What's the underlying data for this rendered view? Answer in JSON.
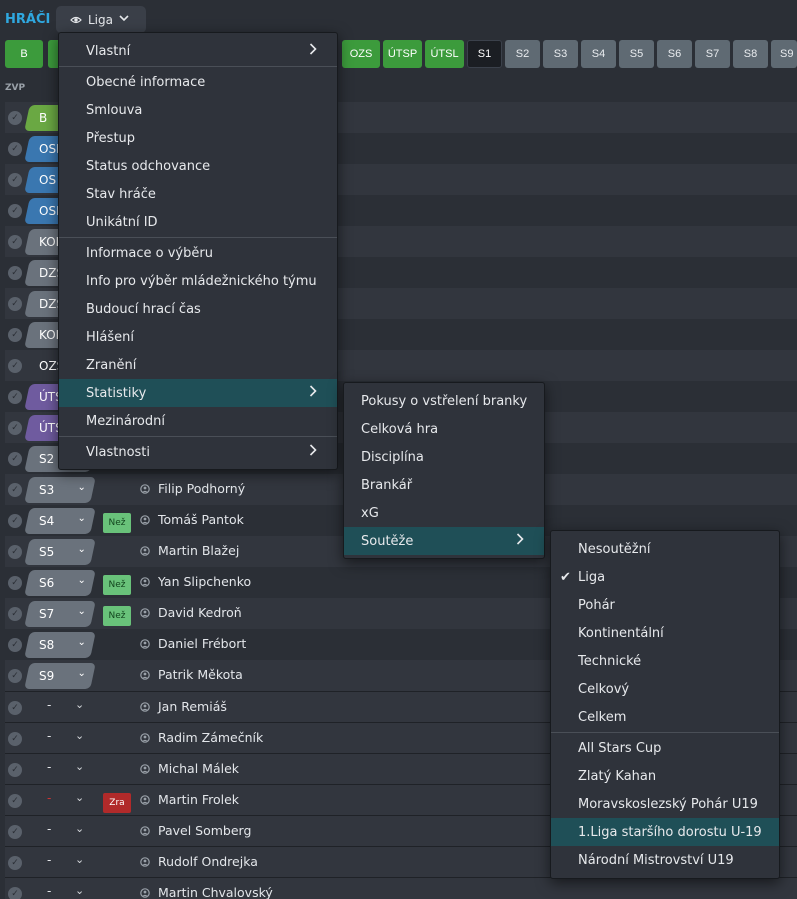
{
  "header": {
    "title": "HRÁČI",
    "view_label": "Liga"
  },
  "chips": [
    "B",
    "OZS",
    "ÚTSP",
    "ÚTSL",
    "S1",
    "S2",
    "S3",
    "S4",
    "S5",
    "S6",
    "S7",
    "S8",
    "S9"
  ],
  "section_label": "ZVP",
  "rows": [
    {
      "pos": "B",
      "color": "green"
    },
    {
      "pos": "OSP",
      "color": "blue"
    },
    {
      "pos": "OS",
      "color": "blue"
    },
    {
      "pos": "OSL",
      "color": "blue"
    },
    {
      "pos": "KOP",
      "color": "grey"
    },
    {
      "pos": "DZS",
      "color": "grey"
    },
    {
      "pos": "DZS",
      "color": "grey"
    },
    {
      "pos": "KOL",
      "color": "grey"
    },
    {
      "pos": "OZS",
      "color": "none"
    },
    {
      "pos": "ÚTSP",
      "color": "purple"
    },
    {
      "pos": "ÚTSL",
      "color": "purple"
    },
    {
      "pos": "S2",
      "color": "grey"
    },
    {
      "pos": "S3",
      "color": "grey",
      "name": "Filip Podhorný"
    },
    {
      "pos": "S4",
      "color": "grey",
      "badge": "Než",
      "name": "Tomáš Pantok"
    },
    {
      "pos": "S5",
      "color": "grey",
      "name": "Martin Blažej"
    },
    {
      "pos": "S6",
      "color": "grey",
      "badge": "Než",
      "name": "Yan Slipchenko"
    },
    {
      "pos": "S7",
      "color": "grey",
      "badge": "Než",
      "name": "David Kedroň"
    },
    {
      "pos": "S8",
      "color": "grey",
      "name": "Daniel Frébort"
    },
    {
      "pos": "S9",
      "color": "grey",
      "name": "Patrik Měkota"
    },
    {
      "pos": "-",
      "name": "Jan Remiáš"
    },
    {
      "pos": "-",
      "name": "Radim Zámečník"
    },
    {
      "pos": "-",
      "name": "Michal Málek"
    },
    {
      "pos": "-",
      "red": true,
      "badge": "Zra",
      "name": "Martin Frolek"
    },
    {
      "pos": "-",
      "name": "Pavel Somberg"
    },
    {
      "pos": "-",
      "name": "Rudolf Ondrejka"
    },
    {
      "pos": "-",
      "name": "Martin Chvalovský"
    }
  ],
  "menu1": {
    "items": [
      {
        "label": "Vlastní",
        "submenu": true
      },
      {
        "label": "Obecné informace"
      },
      {
        "label": "Smlouva"
      },
      {
        "label": "Přestup"
      },
      {
        "label": "Status odchovance"
      },
      {
        "label": "Stav hráče"
      },
      {
        "label": "Unikátní ID"
      },
      {
        "label": "Informace o výběru"
      },
      {
        "label": "Info pro výběr mládežnického týmu"
      },
      {
        "label": "Budoucí hrací čas"
      },
      {
        "label": "Hlášení"
      },
      {
        "label": "Zranění"
      },
      {
        "label": "Statistiky",
        "submenu": true,
        "highlight": true
      },
      {
        "label": "Mezinárodní"
      },
      {
        "label": "Vlastnosti",
        "submenu": true
      }
    ]
  },
  "menu2": {
    "items": [
      {
        "label": "Pokusy o vstřelení branky"
      },
      {
        "label": "Celková hra"
      },
      {
        "label": "Disciplína"
      },
      {
        "label": "Brankář"
      },
      {
        "label": "xG"
      },
      {
        "label": "Soutěže",
        "submenu": true,
        "highlight": true
      }
    ]
  },
  "menu3": {
    "items": [
      {
        "label": "Nesoutěžní"
      },
      {
        "label": "Liga",
        "checked": true
      },
      {
        "label": "Pohár"
      },
      {
        "label": "Kontinentální"
      },
      {
        "label": "Technické"
      },
      {
        "label": "Celkový"
      },
      {
        "label": "Celkem"
      },
      {
        "label": "All Stars Cup"
      },
      {
        "label": "Zlatý Kahan"
      },
      {
        "label": "Moravskoslezský Pohár U19"
      },
      {
        "label": "1.Liga staršího dorostu U-19",
        "highlight": true
      },
      {
        "label": "Národní Mistrovství U19"
      }
    ]
  }
}
